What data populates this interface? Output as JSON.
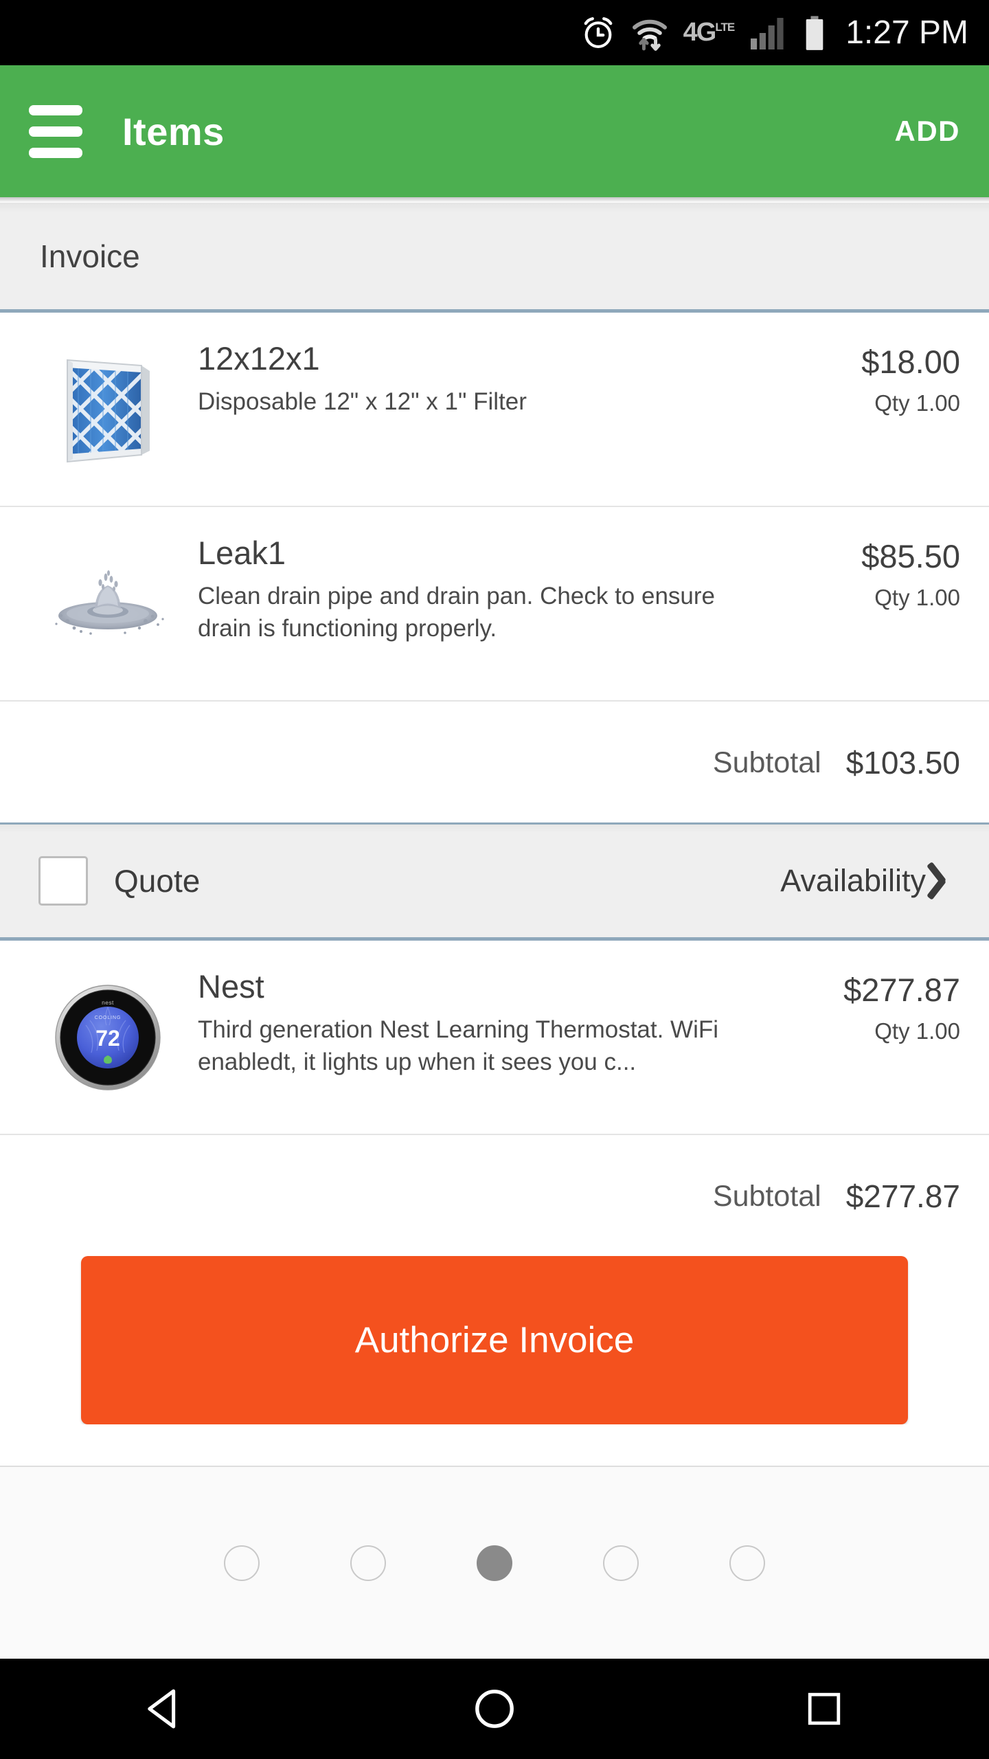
{
  "status_bar": {
    "time": "1:27 PM",
    "network_label_main": "4G",
    "network_label_sub": "LTE",
    "icons": [
      "alarm-icon",
      "wifi-icon",
      "signal-icon",
      "battery-icon"
    ]
  },
  "app_bar": {
    "title": "Items",
    "action_label": "ADD",
    "menu_icon": "hamburger-menu-icon",
    "background_color": "#4CAF50"
  },
  "section": {
    "header_title": "Invoice"
  },
  "invoice_items": [
    {
      "name": "12x12x1",
      "description": "Disposable 12\" x 12\" x 1\" Filter",
      "price": "$18.00",
      "qty": "Qty 1.00",
      "thumbnail": "air-filter-image"
    },
    {
      "name": "Leak1",
      "description": "Clean drain pipe and drain pan. Check to ensure drain is functioning properly.",
      "price": "$85.50",
      "qty": "Qty 1.00",
      "thumbnail": "water-splash-image"
    }
  ],
  "subtotal_1": {
    "label": "Subtotal",
    "value": "$103.50"
  },
  "quote_bar": {
    "checkbox_label": "Quote",
    "checkbox_checked": false,
    "availability_label": "Availability",
    "chevron_icon": "chevron-right-icon"
  },
  "quote_items": [
    {
      "name": "Nest",
      "description": "Third generation Nest Learning Thermostat. WiFi enabledt, it lights up when it sees you c...",
      "price": "$277.87",
      "qty": "Qty 1.00",
      "thumbnail": "nest-thermostat-image",
      "display_temp": "72",
      "display_mode": "COOLING"
    }
  ],
  "subtotal_2": {
    "label": "Subtotal",
    "value": "$277.87"
  },
  "authorize_button": {
    "label": "Authorize Invoice",
    "color": "#F4511E"
  },
  "pager": {
    "total_dots": 5,
    "active_index": 2
  },
  "nav_bar": {
    "back_icon": "back-triangle-icon",
    "home_icon": "home-circle-icon",
    "recents_icon": "recents-square-icon"
  }
}
